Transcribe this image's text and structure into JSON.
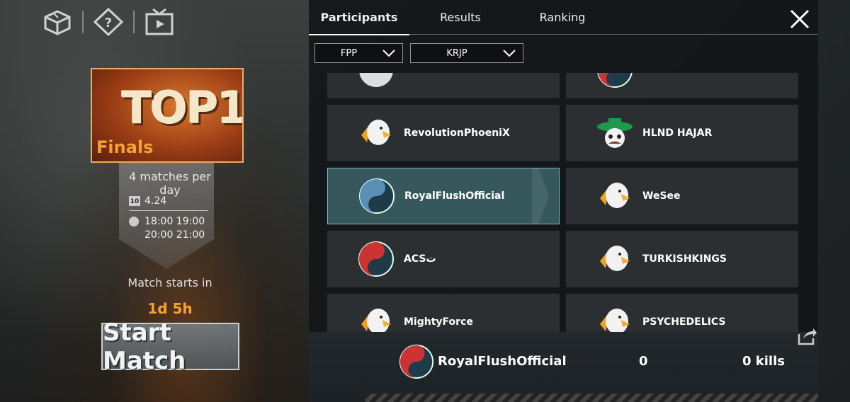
{
  "left": {
    "banner": {
      "big_text": "TOP1",
      "sub_text": "Finals"
    },
    "matches_per_day": "4 matches per day",
    "date": "4.24",
    "calendar_day": "10",
    "times_line1": "18:00 19:00",
    "times_line2": "20:00 21:00",
    "match_starts_label": "Match starts in",
    "countdown": "1d 5h",
    "start_button": "Start Match"
  },
  "tabs": [
    {
      "label": "Participants",
      "active": true
    },
    {
      "label": "Results",
      "active": false
    },
    {
      "label": "Ranking",
      "active": false
    }
  ],
  "filters": {
    "mode": "FPP",
    "region": "KRJP"
  },
  "participants": [
    {
      "name": "",
      "logo": "skull-logo"
    },
    {
      "name": "",
      "logo": "yinyang-logo"
    },
    {
      "name": "RevolutionPhoeniX",
      "logo": "eagle-logo"
    },
    {
      "name": "HLND HAJAR",
      "logo": "sombrero-skull-logo"
    },
    {
      "name": "RoyalFlushOfficial",
      "logo": "yinyang-logo",
      "selected": true
    },
    {
      "name": "WeSee",
      "logo": "eagle-logo"
    },
    {
      "name": "ACSت",
      "logo": "yinyang-logo"
    },
    {
      "name": "TURKISHKINGS",
      "logo": "eagle-logo"
    },
    {
      "name": "MightyForce",
      "logo": "eagle-logo"
    },
    {
      "name": "PSYCHEDELICS",
      "logo": "eagle-logo"
    }
  ],
  "footer": {
    "team": "RoyalFlushOfficial",
    "rank": "0",
    "kills": "0 kills"
  },
  "colors": {
    "accent_orange": "#f6a32e",
    "selected_card": "#3c646a"
  }
}
